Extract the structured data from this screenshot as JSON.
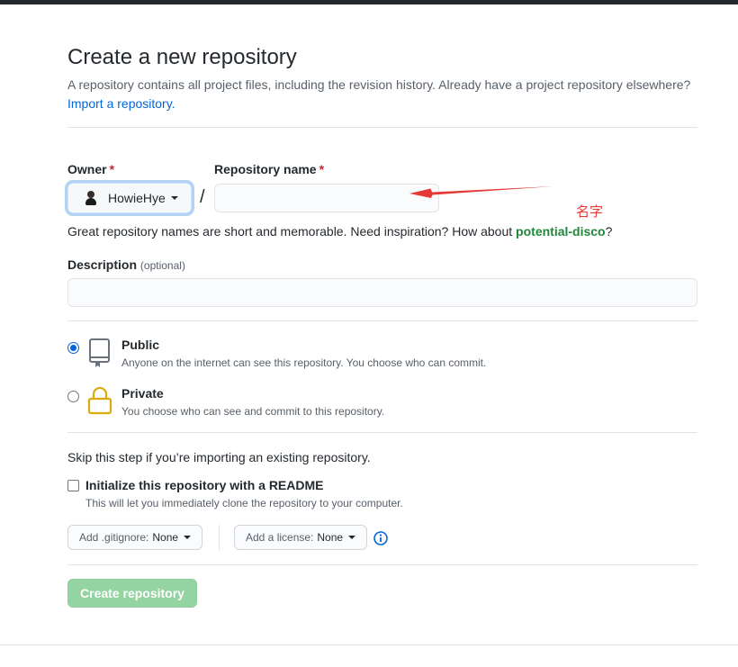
{
  "header": {
    "title": "Create a new repository",
    "subtitle": "A repository contains all project files, including the revision history. Already have a project repository elsewhere?",
    "import_link": "Import a repository."
  },
  "owner": {
    "label": "Owner",
    "required_mark": "*",
    "selected": "HowieHye"
  },
  "repo_name": {
    "label": "Repository name",
    "required_mark": "*",
    "value": "",
    "separator": "/"
  },
  "name_hint": {
    "text": "Great repository names are short and memorable. Need inspiration? How about ",
    "suggestion": "potential-disco",
    "suffix": "?"
  },
  "description": {
    "label": "Description",
    "optional": "(optional)",
    "value": ""
  },
  "visibility": {
    "options": [
      {
        "title": "Public",
        "desc": "Anyone on the internet can see this repository. You choose who can commit.",
        "checked": true
      },
      {
        "title": "Private",
        "desc": "You choose who can see and commit to this repository.",
        "checked": false
      }
    ]
  },
  "init": {
    "skip_text": "Skip this step if you’re importing an existing repository.",
    "readme_label": "Initialize this repository with a README",
    "readme_desc": "This will let you immediately clone the repository to your computer.",
    "gitignore_label": "Add .gitignore:",
    "gitignore_value": "None",
    "license_label": "Add a license:",
    "license_value": "None"
  },
  "submit": {
    "label": "Create repository"
  },
  "annotation": {
    "text": "名字",
    "color": "#e53935"
  },
  "colors": {
    "accent": "#0366d6",
    "success_disabled": "#94d3a2",
    "required": "#cb2431"
  }
}
